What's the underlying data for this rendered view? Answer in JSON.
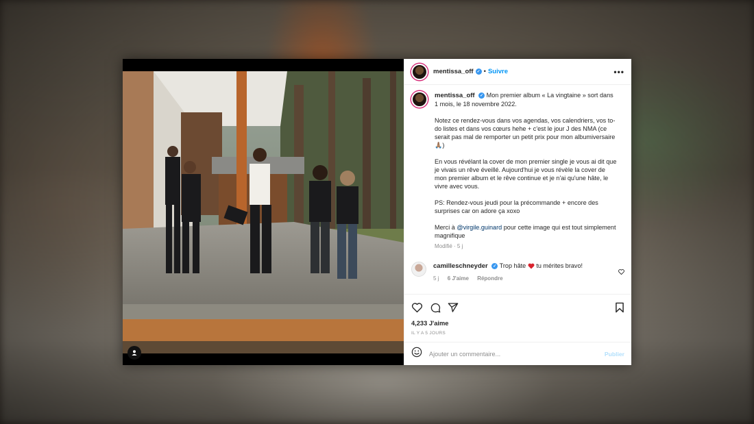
{
  "post": {
    "username": "mentissa_off",
    "follow_label": "Suivre",
    "more_label": "•••",
    "dot": "•",
    "caption": {
      "p1": "Mon premier album « La vingtaine » sort dans 1 mois, le 18 novembre 2022.",
      "p2": "Notez ce rendez-vous dans vos agendas, vos calendriers, vos to-do listes et dans vos cœurs hehe + c'est le jour J des NMA (ce serait pas mal de remporter un petit prix pour mon albumiversaire🙏🏽)",
      "p3": "En vous révélant la cover de mon premier single je vous ai dit que je vivais un rêve éveillé. Aujourd'hui je vous révèle la cover de mon premier album et le rêve continue et je n'ai qu'une hâte, le vivre avec vous.",
      "p4": "PS: Rendez-vous jeudi pour la précommande + encore des surprises car on adore ça xoxo",
      "p5_before": "Merci à ",
      "p5_mention": "@virgile.guinard",
      "p5_after": " pour cette image qui est tout simplement magnifique",
      "meta": "Modifié · 5 j"
    },
    "comment": {
      "username": "camilleschneyder",
      "text_before": "Trop hâte ",
      "text_after": " tu mérites bravo!",
      "age": "5 j",
      "likes": "6 J'aime",
      "reply": "Répondre"
    },
    "likes": "4,233 J'aime",
    "date": "IL Y A 5 JOURS",
    "add_comment": {
      "placeholder": "Ajouter un commentaire...",
      "publish_label": "Publier"
    }
  },
  "colors": {
    "accent": "#0095f6",
    "verified": "#3897f0",
    "heart": "#ed4956"
  }
}
